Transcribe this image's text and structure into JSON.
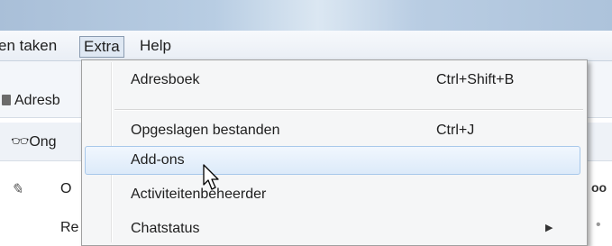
{
  "menubar": {
    "taken": "en taken",
    "extra": "Extra",
    "help": "Help"
  },
  "toolbar": {
    "adres": "Adresb",
    "ong": "Ong"
  },
  "columns": {
    "o": "O",
    "re": "Re"
  },
  "dropdown": {
    "items": [
      {
        "label": "Adresboek",
        "shortcut": "Ctrl+Shift+B"
      },
      {
        "label": "Opgeslagen bestanden",
        "shortcut": "Ctrl+J"
      },
      {
        "label": "Add-ons",
        "shortcut": ""
      },
      {
        "label": "Activiteitenbeheerder",
        "shortcut": ""
      },
      {
        "label": "Chatstatus",
        "shortcut": ""
      }
    ]
  }
}
